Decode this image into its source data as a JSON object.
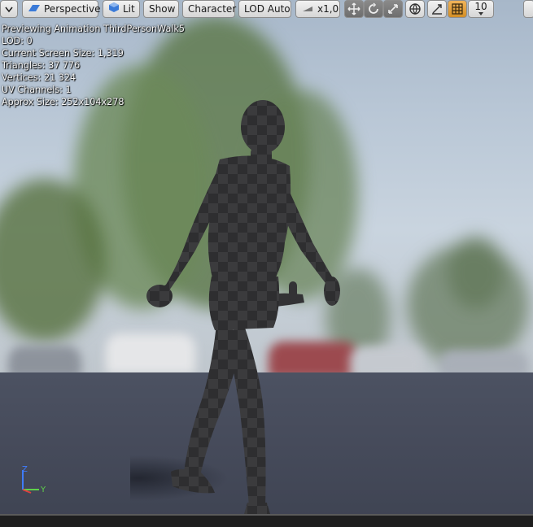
{
  "toolbar": {
    "dropdown_icon": "chevron-down-icon",
    "perspective_label": "Perspective",
    "lit_label": "Lit",
    "show_label": "Show",
    "character_label": "Character",
    "lod_label": "LOD Auto",
    "speed_label": "x1,0",
    "grid_snap_value": "10",
    "accent_color": "#e4a33a"
  },
  "stats": {
    "lines": [
      "Previewing Animation ThirdPersonWalk5",
      "LOD: 0",
      "Current Screen Size: 1,319",
      "Triangles: 37 776",
      "Vertices: 21 324",
      "UV Channels: 1",
      "Approx Size: 252x104x278"
    ]
  },
  "axis": {
    "z": "Z",
    "y": "Y"
  }
}
